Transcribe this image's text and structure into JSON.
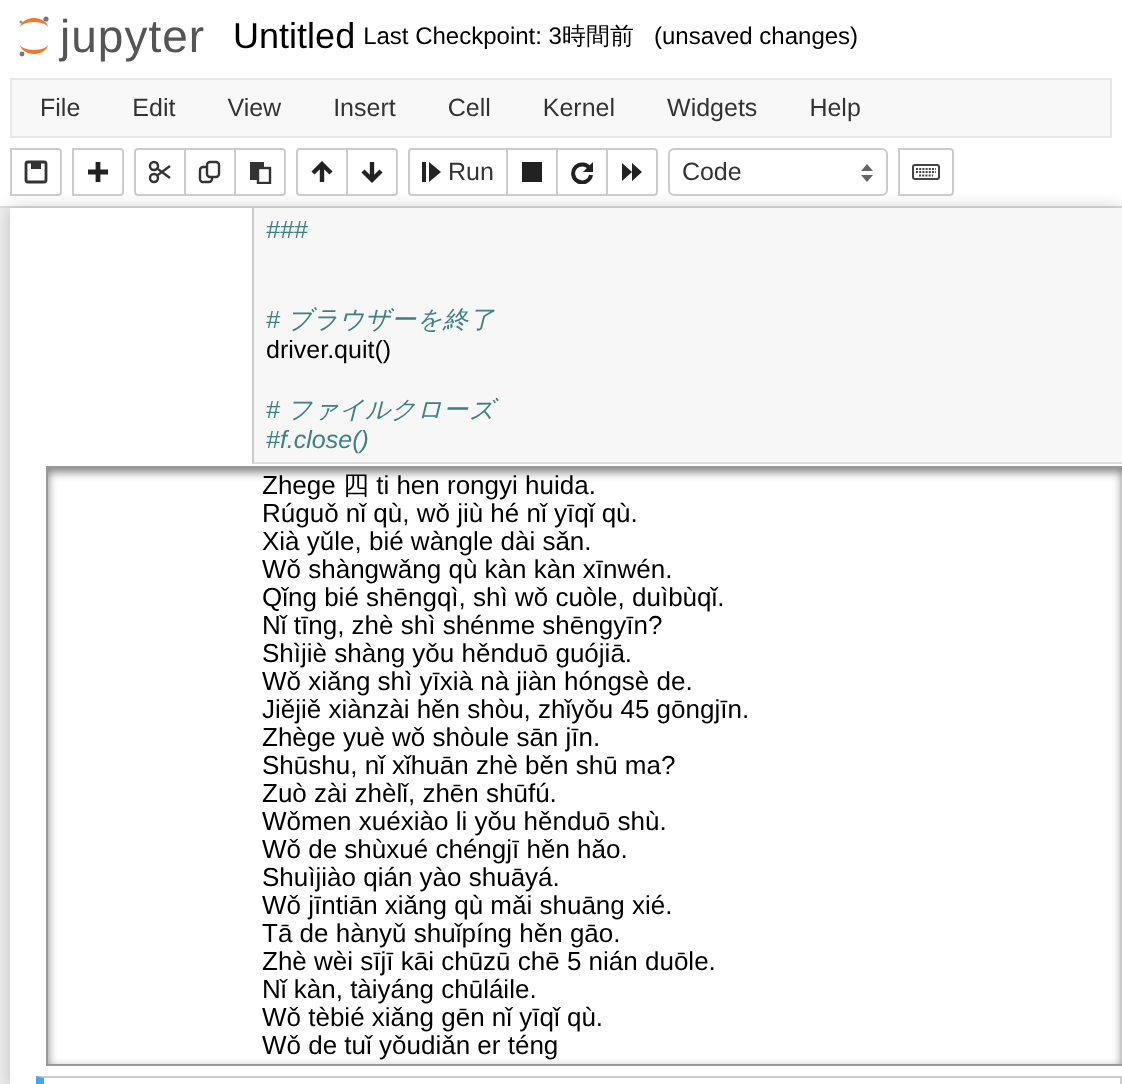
{
  "header": {
    "logo": "jupyter",
    "title": "Untitled",
    "checkpoint": "Last Checkpoint: 3時間前",
    "status": "(unsaved changes)"
  },
  "menu": [
    "File",
    "Edit",
    "View",
    "Insert",
    "Cell",
    "Kernel",
    "Widgets",
    "Help"
  ],
  "toolbar": [
    {
      "kind": "save"
    },
    {
      "kind": "gap"
    },
    {
      "kind": "plus"
    },
    {
      "kind": "gap"
    },
    {
      "kind": "cut"
    },
    {
      "kind": "copy"
    },
    {
      "kind": "paste"
    },
    {
      "kind": "gap"
    },
    {
      "kind": "up"
    },
    {
      "kind": "down"
    },
    {
      "kind": "gap"
    },
    {
      "kind": "run",
      "label": "Run"
    },
    {
      "kind": "stop"
    },
    {
      "kind": "restart"
    },
    {
      "kind": "fastforward"
    },
    {
      "kind": "gap"
    },
    {
      "kind": "select",
      "value": "Code"
    },
    {
      "kind": "gap"
    },
    {
      "kind": "keyboard"
    }
  ],
  "code_cell": {
    "lines": [
      {
        "kind": "comment",
        "text": "###"
      },
      {
        "kind": "blank"
      },
      {
        "kind": "blank"
      },
      {
        "kind": "comment",
        "text": "# ブラウザーを終了"
      },
      {
        "kind": "code",
        "text": "driver.quit()"
      },
      {
        "kind": "blank"
      },
      {
        "kind": "comment",
        "text": "# ファイルクローズ"
      },
      {
        "kind": "comment",
        "text": "#f.close()"
      }
    ]
  },
  "output": {
    "lines": [
      "Zhege 四 ti hen rongyi huida.",
      "Rúguǒ nǐ qù, wǒ jiù hé nǐ yīqǐ qù.",
      "Xià yǔle, bié wàngle dài sǎn.",
      "Wǒ shàngwǎng qù kàn kàn xīnwén.",
      "Qǐng bié shēngqì, shì wǒ cuòle, duìbùqǐ.",
      "Nǐ tīng, zhè shì shénme shēngyīn?",
      "Shìjiè shàng yǒu hěnduō guójiā.",
      "Wǒ xiǎng shì yīxià nà jiàn hóngsè de.",
      "Jiějiě xiànzài hěn shòu, zhǐyǒu 45 gōngjīn.",
      "Zhège yuè wǒ shòule sān jīn.",
      "Shūshu, nǐ xǐhuān zhè běn shū ma?",
      "Zuò zài zhèlǐ, zhēn shūfú.",
      "Wǒmen xuéxiào li yǒu hěnduō shù.",
      "Wǒ de shùxué chéngjī hěn hǎo.",
      "Shuìjiào qián yào shuāyá.",
      "Wǒ jīntiān xiǎng qù mǎi shuāng xié.",
      "Tā de hànyǔ shuǐpíng hěn gāo.",
      "Zhè wèi sījī kāi chūzū chē 5 nián duōle.",
      "Nǐ kàn, tàiyáng chūláile.",
      "Wǒ tèbié xiǎng gēn nǐ yīqǐ qù.",
      "Wǒ de tuǐ yǒudiǎn er téng"
    ]
  },
  "next_cell": {
    "selected": true
  }
}
